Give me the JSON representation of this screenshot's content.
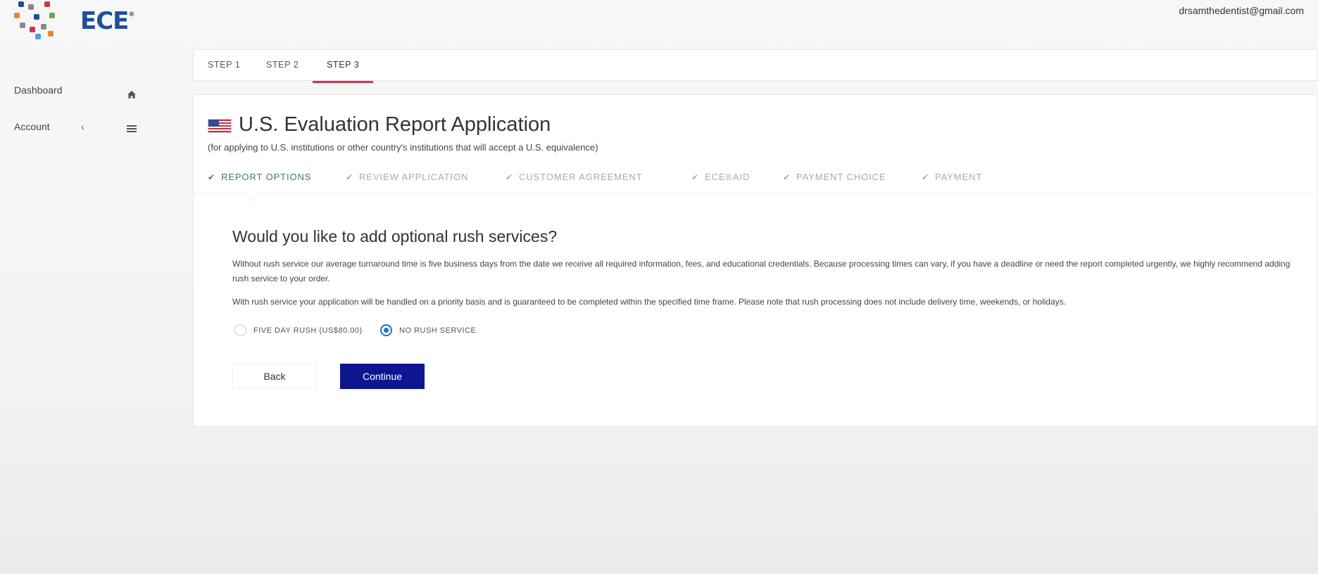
{
  "header": {
    "logo_text": "ECE",
    "logo_mark": "®",
    "user_email": "drsamthedentist@gmail.com"
  },
  "sidebar": {
    "items": [
      {
        "label": "Dashboard",
        "icon": "home-icon"
      },
      {
        "label": "Account",
        "icon": "menu-icon",
        "chevron": "‹"
      }
    ]
  },
  "steps": {
    "tabs": [
      "STEP 1",
      "STEP 2",
      "STEP 3"
    ],
    "active_index": 2
  },
  "application": {
    "flag": "us-flag-icon",
    "title": "U.S. Evaluation Report Application",
    "subtitle": "(for applying to U.S. institutions or other country's institutions that will accept a U.S. equivalence)",
    "progress": [
      {
        "label": "REPORT OPTIONS",
        "active": true
      },
      {
        "label": "REVIEW APPLICATION",
        "active": false
      },
      {
        "label": "CUSTOMER AGREEMENT",
        "active": false
      },
      {
        "label": "ECE®AID",
        "active": false
      },
      {
        "label": "PAYMENT CHOICE",
        "active": false
      },
      {
        "label": "PAYMENT",
        "active": false
      }
    ]
  },
  "rush": {
    "question": "Would you like to add optional rush services?",
    "para1": "Without rush service our average turnaround time is five business days from the date we receive all required information, fees, and educational credentials. Because processing times can vary, if you have a deadline or need the report completed urgently, we highly recommend adding rush service to your order.",
    "para2": "With rush service your application will be handled on a priority basis and is guaranteed to be completed within the specified time frame. Please note that rush processing does not include delivery time, weekends, or holidays.",
    "options": [
      {
        "label": "FIVE DAY RUSH (US$80.00)",
        "selected": false
      },
      {
        "label": "NO RUSH SERVICE",
        "selected": true
      }
    ]
  },
  "buttons": {
    "back": "Back",
    "continue": "Continue"
  },
  "colors": {
    "brand_blue": "#1f4e9a",
    "active_step": "#d6334a",
    "active_progress": "#3f7f4b",
    "continue_button": "#0d1690",
    "radio_selected": "#1b73d6"
  }
}
